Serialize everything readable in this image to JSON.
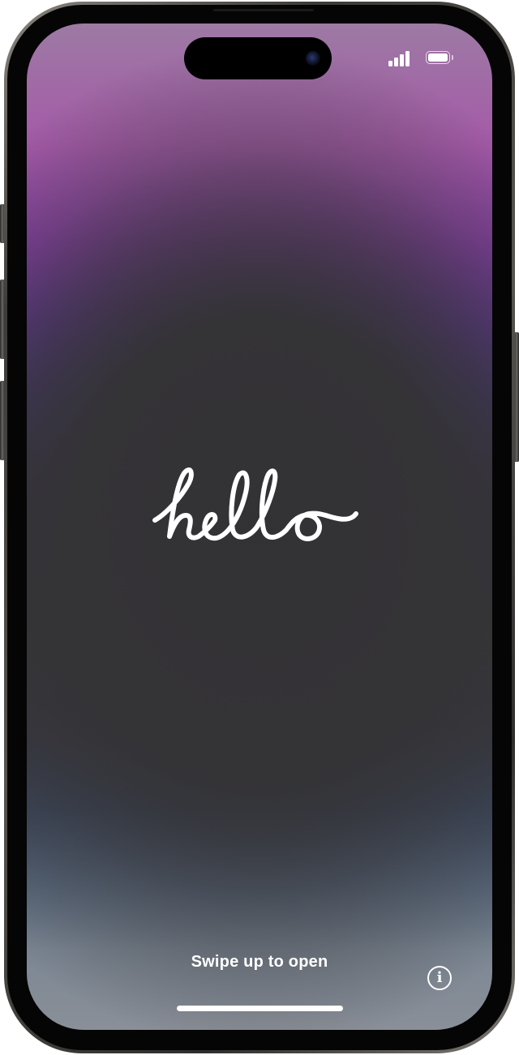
{
  "device": {
    "model_style": "phone",
    "frame_color": "#3d3b38"
  },
  "status_bar": {
    "signal_icon": "cellular-signal-icon",
    "signal_bars": 4,
    "battery_icon": "battery-icon",
    "battery_level": 1.0
  },
  "wallpaper": {
    "top_color": "#a55aa8",
    "purple_color": "#6b37a8",
    "center_color": "#353437",
    "lower_blue_color": "#3c4a63",
    "bottom_color": "#8a8f98"
  },
  "greeting": {
    "word": "hello",
    "color": "#ffffff"
  },
  "lock_screen": {
    "swipe_label": "Swipe up to open",
    "info_icon": "info-icon",
    "info_glyph": "i"
  }
}
